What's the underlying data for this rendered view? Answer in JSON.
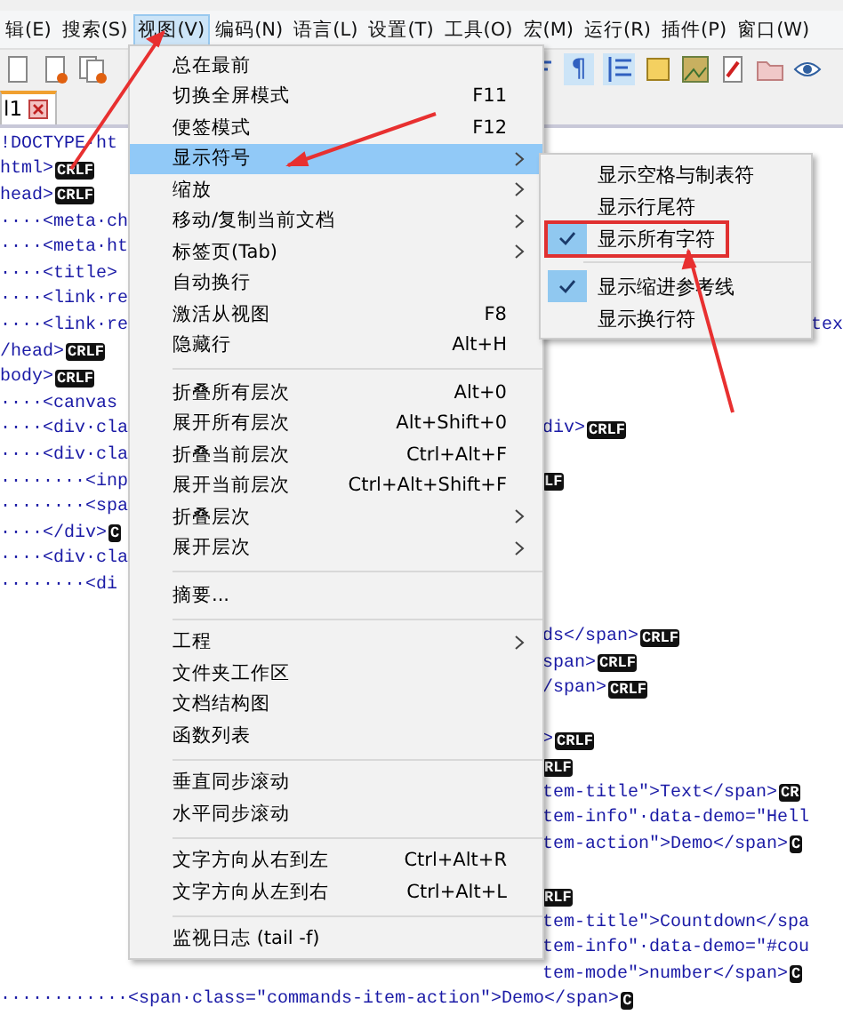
{
  "menubar": [
    {
      "label": "辑(E)",
      "selected": false
    },
    {
      "label": "搜索(S)",
      "selected": false
    },
    {
      "label": "视图(V)",
      "selected": true
    },
    {
      "label": "编码(N)",
      "selected": false
    },
    {
      "label": "语言(L)",
      "selected": false
    },
    {
      "label": "设置(T)",
      "selected": false
    },
    {
      "label": "工具(O)",
      "selected": false
    },
    {
      "label": "宏(M)",
      "selected": false
    },
    {
      "label": "运行(R)",
      "selected": false
    },
    {
      "label": "插件(P)",
      "selected": false
    },
    {
      "label": "窗口(W)",
      "selected": false
    }
  ],
  "toolbar": {
    "pilcrow": "¶"
  },
  "tabs": [
    {
      "label": "l1",
      "selected": true
    }
  ],
  "editor": {
    "lines": [
      {
        "kind": "split",
        "code": "!DOCTYPE·ht"
      },
      {
        "kind": "split",
        "code": "html>",
        "eol": "CRLF"
      },
      {
        "kind": "split",
        "code": "head>",
        "eol": "CRLF"
      },
      {
        "kind": "split",
        "code": "····<meta·ch"
      },
      {
        "kind": "split",
        "code": "····<meta·ht"
      },
      {
        "kind": "split",
        "code": "····<title>"
      },
      {
        "kind": "split",
        "code": "····<link·re"
      },
      {
        "kind": "edge",
        "code": "····<link·re",
        "tail": "tex"
      },
      {
        "kind": "split",
        "code": "/head>",
        "eol": "CRLF"
      },
      {
        "kind": "split",
        "code": "body>",
        "eol": "CRLF"
      },
      {
        "kind": "split",
        "code": "····<canvas"
      },
      {
        "kind": "split",
        "code": "····<div·cla",
        "tail": "div>",
        "tail_eol": "CRLF"
      },
      {
        "kind": "split",
        "code": "····<div·cla"
      },
      {
        "kind": "split",
        "code": "········<inp",
        "tail_eol": "LF"
      },
      {
        "kind": "split",
        "code": "········<spa"
      },
      {
        "kind": "split",
        "code": "····</div>",
        "eol": "C"
      },
      {
        "kind": "split",
        "code": "····<div·cla"
      },
      {
        "kind": "split",
        "code": "········<di"
      },
      {
        "kind": "split"
      },
      {
        "kind": "split",
        "tail": "ds</span>",
        "tail_eol": "CRLF"
      },
      {
        "kind": "split",
        "tail": "span>",
        "tail_eol": "CRLF"
      },
      {
        "kind": "split",
        "tail": "/span>",
        "tail_eol": "CRLF"
      },
      {
        "kind": "split"
      },
      {
        "kind": "split",
        "tail": ">",
        "tail_eol": "CRLF"
      },
      {
        "kind": "split",
        "tail_eol": "RLF"
      },
      {
        "kind": "split",
        "tail": "tem-title\">Text</span>",
        "tail_eol": "CR"
      },
      {
        "kind": "split",
        "tail": "tem-info\"·data-demo=\"Hell"
      },
      {
        "kind": "split",
        "tail": "tem-action\">Demo</span>",
        "tail_eol": "C"
      },
      {
        "kind": "split"
      },
      {
        "kind": "split",
        "tail_eol": "RLF"
      },
      {
        "kind": "split",
        "tail": "tem-title\">Countdown</spa"
      },
      {
        "kind": "split",
        "tail": "tem-info\"·data-demo=\"#cou"
      },
      {
        "kind": "split",
        "tail": "tem-mode\">number</span>",
        "tail_eol": "C"
      },
      {
        "kind": "full",
        "code": "············<span·class=\"commands-item-action\">Demo</span>",
        "eol": "C"
      }
    ]
  },
  "menu": [
    {
      "kind": "item",
      "label": "总在最前",
      "selected": false,
      "submenu": false
    },
    {
      "kind": "item",
      "label": "切换全屏模式",
      "shortcut": "F11",
      "selected": false,
      "submenu": false
    },
    {
      "kind": "item",
      "label": "便签模式",
      "shortcut": "F12",
      "selected": false,
      "submenu": false
    },
    {
      "kind": "item",
      "label": "显示符号",
      "selected": true,
      "submenu": true
    },
    {
      "kind": "item",
      "label": "缩放",
      "selected": false,
      "submenu": true
    },
    {
      "kind": "item",
      "label": "移动/复制当前文档",
      "selected": false,
      "submenu": true
    },
    {
      "kind": "item",
      "label": "标签页(Tab)",
      "selected": false,
      "submenu": true
    },
    {
      "kind": "item",
      "label": "自动换行",
      "selected": false,
      "submenu": false
    },
    {
      "kind": "item",
      "label": "激活从视图",
      "shortcut": "F8",
      "selected": false,
      "submenu": false
    },
    {
      "kind": "item",
      "label": "隐藏行",
      "shortcut": "Alt+H",
      "selected": false,
      "submenu": false
    },
    {
      "kind": "separator"
    },
    {
      "kind": "item",
      "label": "折叠所有层次",
      "shortcut": "Alt+0",
      "selected": false,
      "submenu": false
    },
    {
      "kind": "item",
      "label": "展开所有层次",
      "shortcut": "Alt+Shift+0",
      "selected": false,
      "submenu": false
    },
    {
      "kind": "item",
      "label": "折叠当前层次",
      "shortcut": "Ctrl+Alt+F",
      "selected": false,
      "submenu": false
    },
    {
      "kind": "item",
      "label": "展开当前层次",
      "shortcut": "Ctrl+Alt+Shift+F",
      "selected": false,
      "submenu": false
    },
    {
      "kind": "item",
      "label": "折叠层次",
      "selected": false,
      "submenu": true
    },
    {
      "kind": "item",
      "label": "展开层次",
      "selected": false,
      "submenu": true
    },
    {
      "kind": "separator"
    },
    {
      "kind": "item",
      "label": "摘要...",
      "selected": false,
      "submenu": false
    },
    {
      "kind": "separator"
    },
    {
      "kind": "item",
      "label": "工程",
      "selected": false,
      "submenu": true
    },
    {
      "kind": "item",
      "label": "文件夹工作区",
      "selected": false,
      "submenu": false
    },
    {
      "kind": "item",
      "label": "文档结构图",
      "selected": false,
      "submenu": false
    },
    {
      "kind": "item",
      "label": "函数列表",
      "selected": false,
      "submenu": false
    },
    {
      "kind": "separator"
    },
    {
      "kind": "item",
      "label": "垂直同步滚动",
      "selected": false,
      "submenu": false
    },
    {
      "kind": "item",
      "label": "水平同步滚动",
      "selected": false,
      "submenu": false
    },
    {
      "kind": "separator"
    },
    {
      "kind": "item",
      "label": "文字方向从右到左",
      "shortcut": "Ctrl+Alt+R",
      "selected": false,
      "submenu": false
    },
    {
      "kind": "item",
      "label": "文字方向从左到右",
      "shortcut": "Ctrl+Alt+L",
      "selected": false,
      "submenu": false
    },
    {
      "kind": "separator"
    },
    {
      "kind": "item",
      "label": "监视日志 (tail -f)",
      "selected": false,
      "submenu": false
    }
  ],
  "submenu": [
    {
      "kind": "item",
      "label": "显示空格与制表符",
      "checked": false,
      "boxed": false
    },
    {
      "kind": "item",
      "label": "显示行尾符",
      "checked": false,
      "boxed": false
    },
    {
      "kind": "item",
      "label": "显示所有字符",
      "checked": true,
      "boxed": true
    },
    {
      "kind": "separator"
    },
    {
      "kind": "item",
      "label": "显示缩进参考线",
      "checked": true,
      "boxed": false
    },
    {
      "kind": "item",
      "label": "显示换行符",
      "checked": false,
      "boxed": false
    }
  ]
}
